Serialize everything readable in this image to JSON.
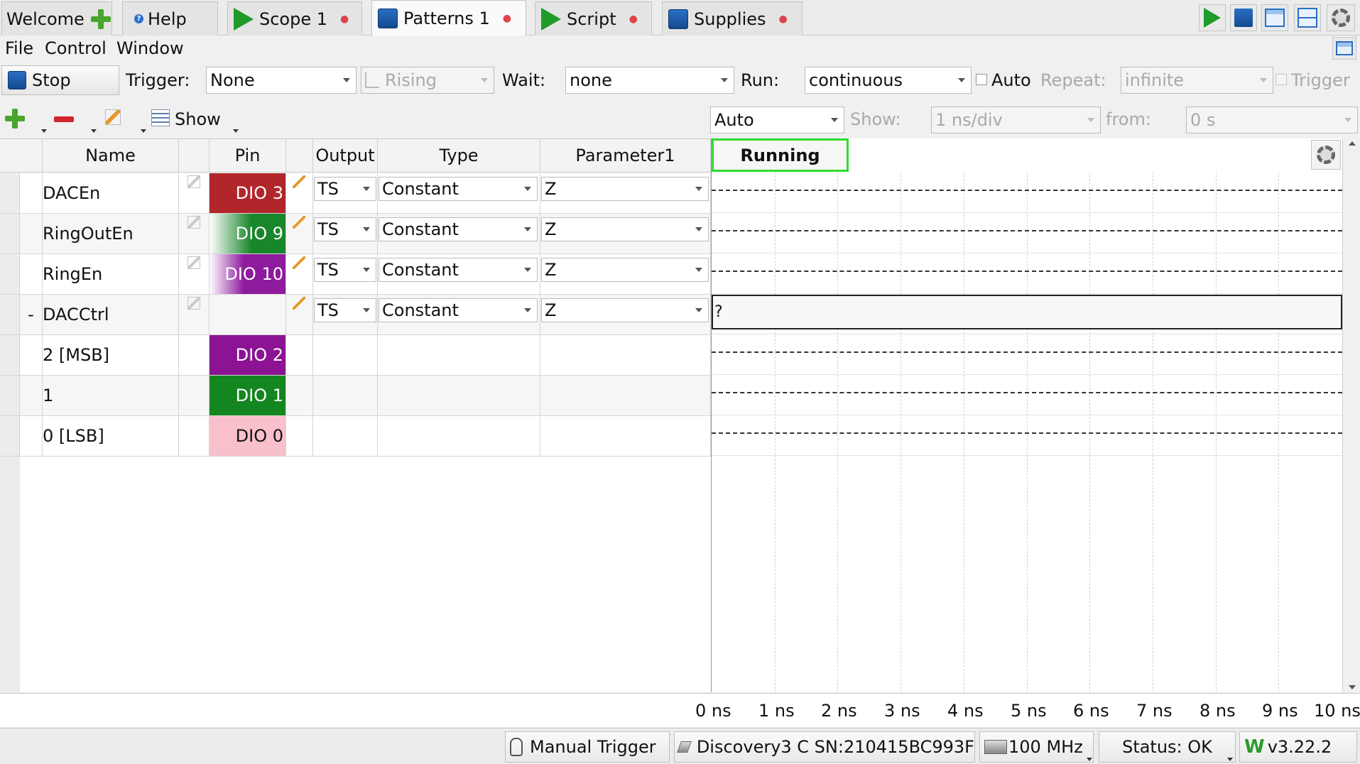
{
  "tabs": [
    {
      "label": "Welcome",
      "icon": "add-icon"
    },
    {
      "label": "Help",
      "icon": "help-icon"
    },
    {
      "label": "Scope 1",
      "icon": "play-icon"
    },
    {
      "label": "Patterns 1",
      "icon": "stop-icon"
    },
    {
      "label": "Script",
      "icon": "play-icon"
    },
    {
      "label": "Supplies",
      "icon": "stop-icon"
    }
  ],
  "menu": {
    "file": "File",
    "control": "Control",
    "window": "Window"
  },
  "toolbar1": {
    "stop_label": "Stop",
    "trigger_label": "Trigger:",
    "trigger_value": "None",
    "edge_value": "Rising",
    "wait_label": "Wait:",
    "wait_value": "none",
    "run_label": "Run:",
    "run_value": "continuous",
    "auto_label": "Auto",
    "repeat_label": "Repeat:",
    "repeat_value": "infinite",
    "trigger_check_label": "Trigger"
  },
  "toolbar2": {
    "show_label": "Show",
    "mode_value": "Auto",
    "show_field_label": "Show:",
    "timebase_value": "1 ns/div",
    "from_label": "from:",
    "from_value": "0 s"
  },
  "grid": {
    "headers": {
      "name": "Name",
      "pin": "Pin",
      "output": "Output",
      "type": "Type",
      "param": "Parameter1"
    },
    "rows": [
      {
        "prefix": "",
        "name": "DACEn",
        "pin": "DIO 3",
        "pin_color": "#b1262b",
        "output": "TS",
        "type": "Constant",
        "param": "Z"
      },
      {
        "prefix": "",
        "name": "RingOutEn",
        "pin": "DIO 9",
        "pin_color": "#18862a",
        "output": "TS",
        "type": "Constant",
        "param": "Z"
      },
      {
        "prefix": "",
        "name": "RingEn",
        "pin": "DIO 10",
        "pin_color": "#8e1b9e",
        "output": "TS",
        "type": "Constant",
        "param": "Z"
      },
      {
        "prefix": "-",
        "name": "DACCtrl",
        "pin": "",
        "pin_color": "",
        "output": "TS",
        "type": "Constant",
        "param": "Z"
      },
      {
        "prefix": "",
        "name": "2 [MSB]",
        "pin": "DIO 2",
        "pin_color": "#8b1394",
        "output": "",
        "type": "",
        "param": ""
      },
      {
        "prefix": "",
        "name": "1",
        "pin": "DIO 1",
        "pin_color": "#14861f",
        "output": "",
        "type": "",
        "param": ""
      },
      {
        "prefix": "",
        "name": "0 [LSB]",
        "pin": "DIO 0",
        "pin_color": "#f8c0cb",
        "output": "",
        "type": "",
        "param": ""
      }
    ]
  },
  "plot": {
    "status": "Running",
    "bus_value": "?",
    "time_ticks": [
      "0 ns",
      "1 ns",
      "2 ns",
      "3 ns",
      "4 ns",
      "5 ns",
      "6 ns",
      "7 ns",
      "8 ns",
      "9 ns",
      "10 ns"
    ]
  },
  "statusbar": {
    "manual_trigger": "Manual Trigger",
    "device": "Discovery3 C SN:210415BC993F",
    "clock": "100 MHz",
    "status": "Status: OK",
    "version": "v3.22.2"
  }
}
